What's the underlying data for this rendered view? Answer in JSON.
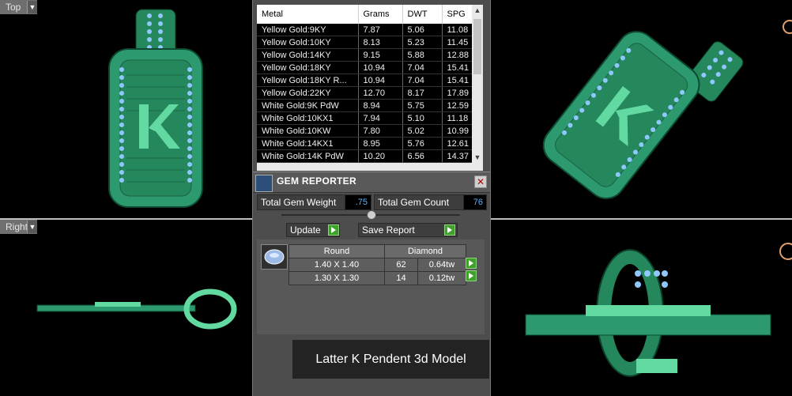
{
  "viewports": {
    "top_label": "Top",
    "right_label": "Right"
  },
  "metal_table": {
    "headers": [
      "Metal",
      "Grams",
      "DWT",
      "SPG"
    ],
    "rows": [
      [
        "Yellow Gold:9KY",
        "7.87",
        "5.06",
        "11.08"
      ],
      [
        "Yellow Gold:10KY",
        "8.13",
        "5.23",
        "11.45"
      ],
      [
        "Yellow Gold:14KY",
        "9.15",
        "5.88",
        "12.88"
      ],
      [
        "Yellow Gold:18KY",
        "10.94",
        "7.04",
        "15.41"
      ],
      [
        "Yellow Gold:18KY R...",
        "10.94",
        "7.04",
        "15.41"
      ],
      [
        "Yellow Gold:22KY",
        "12.70",
        "8.17",
        "17.89"
      ],
      [
        "White Gold:9K PdW",
        "8.94",
        "5.75",
        "12.59"
      ],
      [
        "White Gold:10KX1",
        "7.94",
        "5.10",
        "11.18"
      ],
      [
        "White Gold:10KW",
        "7.80",
        "5.02",
        "10.99"
      ],
      [
        "White Gold:14KX1",
        "8.95",
        "5.76",
        "12.61"
      ],
      [
        "White Gold:14K PdW",
        "10.20",
        "6.56",
        "14.37"
      ]
    ]
  },
  "gem_reporter": {
    "title": "GEM REPORTER",
    "close": "✕",
    "total_weight_label": "Total Gem Weight",
    "total_weight_value": ".75",
    "total_count_label": "Total Gem Count",
    "total_count_value": "76",
    "update_label": "Update",
    "save_report_label": "Save Report",
    "grid_headers": [
      "Round",
      "Diamond"
    ],
    "grid_rows": [
      {
        "size": "1.40 X 1.40",
        "count": "62",
        "weight": "0.64tw"
      },
      {
        "size": "1.30 X 1.30",
        "count": "14",
        "weight": "0.12tw"
      }
    ]
  },
  "caption": "Latter K Pendent 3d Model",
  "colors": {
    "metal": "#2c9a6e",
    "metal_light": "#61d9a0",
    "gem": "#8fc8ff",
    "panel": "#4d4d4d"
  }
}
